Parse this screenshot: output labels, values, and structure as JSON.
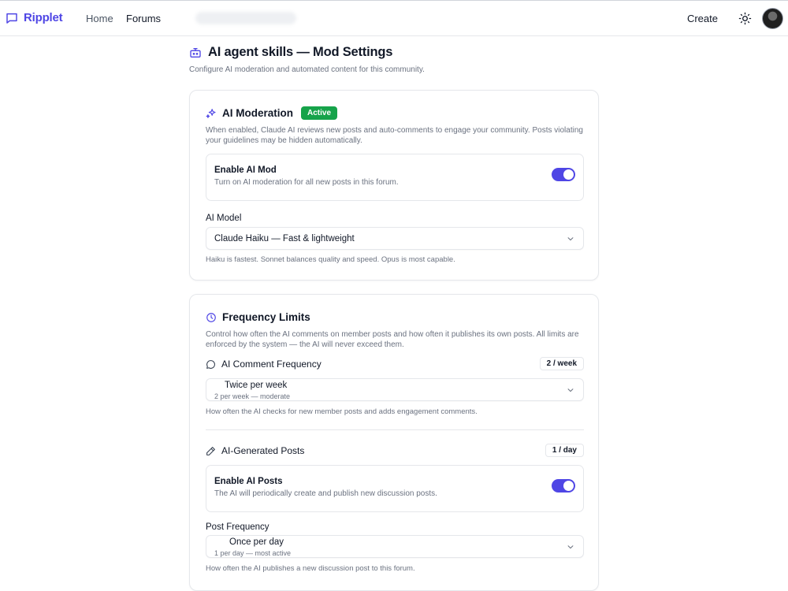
{
  "nav": {
    "brand": "Ripplet",
    "links": [
      "Home",
      "Forums"
    ],
    "create_label": "Create",
    "icons": {
      "brand": "chat-bubble-icon",
      "theme": "sun-icon"
    }
  },
  "page": {
    "title": "AI agent skills — Mod Settings",
    "subtitle": "Configure AI moderation and automated content for this community.",
    "icon": "robot-icon"
  },
  "moderation": {
    "title": "AI Moderation",
    "badge": "Active",
    "description": "When enabled, Claude AI reviews new posts and auto-comments to engage your community. Posts violating your guidelines may be hidden automatically.",
    "enable": {
      "title": "Enable AI Mod",
      "subtitle": "Turn on AI moderation for all new posts in this forum.",
      "on": true
    },
    "model_label": "AI Model",
    "model_value": "Claude Haiku — Fast & lightweight",
    "model_hint": "Haiku is fastest. Sonnet balances quality and speed. Opus is most capable."
  },
  "frequency": {
    "title": "Frequency Limits",
    "description": "Control how often the AI comments on member posts and how often it publishes its own posts. All limits are enforced by the system — the AI will never exceed them.",
    "comment": {
      "label": "AI Comment Frequency",
      "pill": "2 / week",
      "value": "Twice per week",
      "value_sub": "2 per week — moderate",
      "hint": "How often the AI checks for new member posts and adds engagement comments."
    },
    "posts": {
      "label": "AI-Generated Posts",
      "pill": "1 / day",
      "enable_title": "Enable AI Posts",
      "enable_subtitle": "The AI will periodically create and publish new discussion posts.",
      "on": true,
      "freq_label": "Post Frequency",
      "value": "Once per day",
      "value_sub": "1 per day — most active",
      "hint": "How often the AI publishes a new discussion post to this forum."
    }
  },
  "colors": {
    "accent": "#4f46e5",
    "active_badge": "#16a34a"
  }
}
